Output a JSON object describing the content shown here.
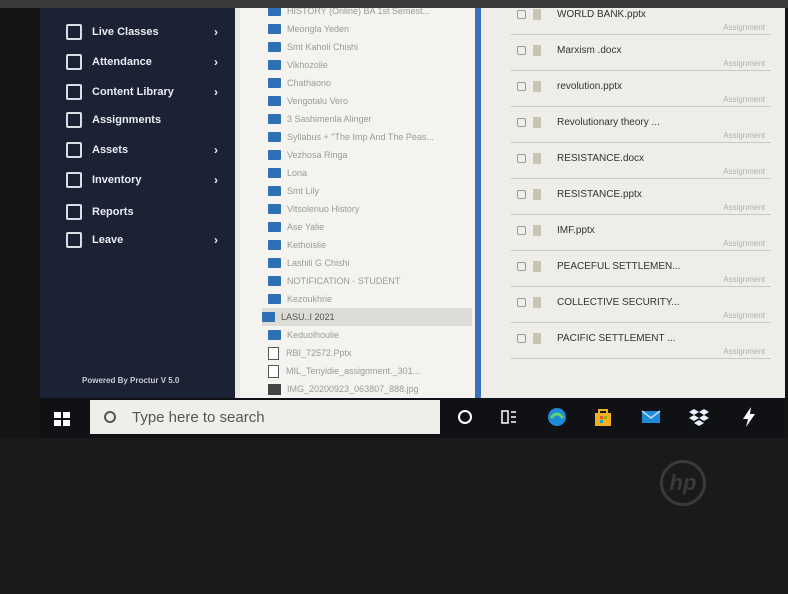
{
  "sidebar": {
    "items": [
      {
        "label": "Live Classes",
        "has_submenu": true
      },
      {
        "label": "Attendance",
        "has_submenu": true
      },
      {
        "label": "Content Library",
        "has_submenu": true
      },
      {
        "label": "Assignments",
        "has_submenu": false
      },
      {
        "label": "Assets",
        "has_submenu": true
      },
      {
        "label": "Inventory",
        "has_submenu": true
      },
      {
        "label": "Reports",
        "has_submenu": false
      },
      {
        "label": "Leave",
        "has_submenu": true
      }
    ],
    "chevron": "›",
    "powered_by": "Powered By Proctur V 5.0"
  },
  "file_list": [
    {
      "name": "HISTORY (Online) BA 1st Semest...",
      "kind": "folder"
    },
    {
      "name": "Meongla Yeden",
      "kind": "folder"
    },
    {
      "name": "Smt Kaholi Chishi",
      "kind": "folder"
    },
    {
      "name": "Vikhozolie",
      "kind": "folder"
    },
    {
      "name": "Chathaono",
      "kind": "folder"
    },
    {
      "name": "Vengotalu Vero",
      "kind": "folder"
    },
    {
      "name": "3 Sashimenla Alinger",
      "kind": "folder"
    },
    {
      "name": "Syllabus + \"The Imp And The Peas...",
      "kind": "folder"
    },
    {
      "name": "Vezhosa Ringa",
      "kind": "folder"
    },
    {
      "name": "Lona",
      "kind": "folder"
    },
    {
      "name": "Smt Lily",
      "kind": "folder"
    },
    {
      "name": "Vitsolenuo History",
      "kind": "folder"
    },
    {
      "name": "Ase Yalie",
      "kind": "folder"
    },
    {
      "name": "Kethoislie",
      "kind": "folder"
    },
    {
      "name": "Lashili G Chishi",
      "kind": "folder"
    },
    {
      "name": "NOTIFICATION - STUDENT",
      "kind": "folder"
    },
    {
      "name": "Kezoukhrie",
      "kind": "folder"
    },
    {
      "name": "LASU..I 2021",
      "kind": "folder",
      "selected": true
    },
    {
      "name": "Keduolhoulie",
      "kind": "folder"
    },
    {
      "name": "RBI_72572.Pptx",
      "kind": "doc"
    },
    {
      "name": "MIL_Tenyidie_assignment._301...",
      "kind": "doc"
    },
    {
      "name": "IMG_20200923_063807_888.jpg",
      "kind": "image"
    }
  ],
  "assignments": [
    {
      "name": "WORLD BANK.pptx",
      "tag": "Assignment"
    },
    {
      "name": "Marxism .docx",
      "tag": "Assignment"
    },
    {
      "name": "revolution.pptx",
      "tag": "Assignment"
    },
    {
      "name": "Revolutionary theory ...",
      "tag": "Assignment"
    },
    {
      "name": "RESISTANCE.docx",
      "tag": "Assignment"
    },
    {
      "name": "RESISTANCE.pptx",
      "tag": "Assignment"
    },
    {
      "name": "IMF.pptx",
      "tag": "Assignment"
    },
    {
      "name": "PEACEFUL SETTLEMEN...",
      "tag": "Assignment"
    },
    {
      "name": "COLLECTIVE SECURITY...",
      "tag": "Assignment"
    },
    {
      "name": "PACIFIC SETTLEMENT ...",
      "tag": "Assignment"
    }
  ],
  "taskbar": {
    "search_placeholder": "Type here to search",
    "icons": [
      "start-icon",
      "cortana-icon",
      "task-view-icon",
      "edge-icon",
      "store-icon",
      "mail-icon",
      "dropbox-icon",
      "lightning-icon"
    ]
  },
  "colors": {
    "sidebar_bg": "#1b2233",
    "folder_blue": "#2d70b3",
    "divider_blue": "#3d6fc0",
    "edge_blue": "#1f8ad8",
    "store_yellow": "#f2b020"
  },
  "bezel_logo": "hp"
}
